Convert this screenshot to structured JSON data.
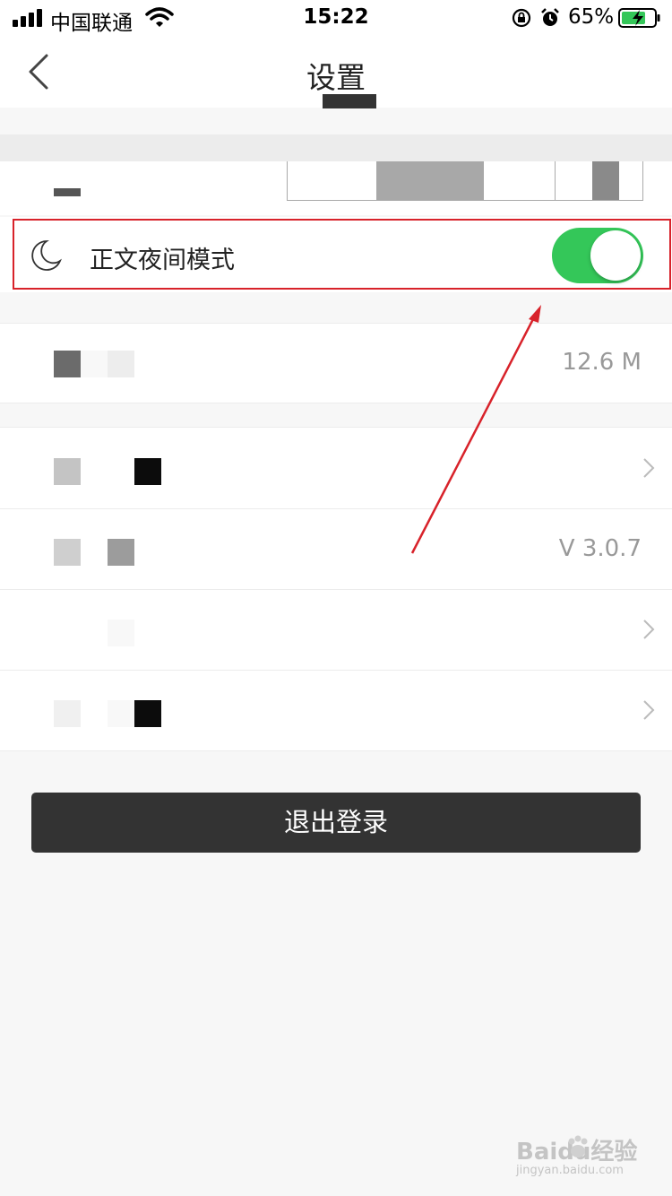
{
  "status_bar": {
    "carrier": "中国联通",
    "time": "15:22",
    "battery_percent": "65%"
  },
  "nav": {
    "title": "设置"
  },
  "night_mode": {
    "label": "正文夜间模式",
    "enabled": true
  },
  "cache": {
    "value": "12.6 M"
  },
  "version": {
    "value": "V 3.0.7"
  },
  "logout": {
    "label": "退出登录"
  },
  "watermark": {
    "brand": "Baidu经验",
    "url": "jingyan.baidu.com"
  },
  "colors": {
    "toggle_on": "#34c759",
    "highlight": "#d8222a",
    "logout_bg": "#333333"
  },
  "icons": [
    "signal-icon",
    "wifi-icon",
    "rotation-lock-icon",
    "alarm-icon",
    "battery-charging-icon",
    "back-icon",
    "moon-icon",
    "chevron-right-icon"
  ]
}
